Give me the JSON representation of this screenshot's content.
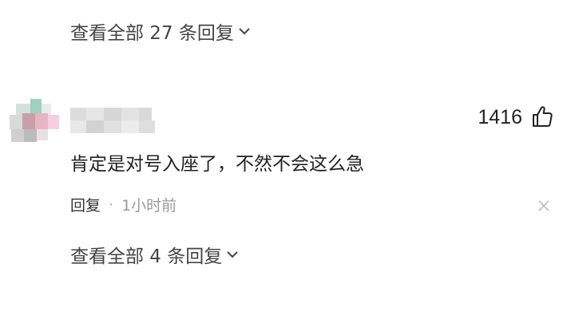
{
  "replies_top": {
    "label": "查看全部 27 条回复"
  },
  "comment": {
    "likes": "1416",
    "text": "肯定是对号入座了，不然不会这么急",
    "reply_label": "回复",
    "separator": "·",
    "time": "1小时前"
  },
  "replies_bottom": {
    "label": "查看全部 4 条回复"
  },
  "icons": {
    "expand": "chevron-down-icon",
    "like": "thumbs-up-icon",
    "dismiss": "close-icon"
  }
}
